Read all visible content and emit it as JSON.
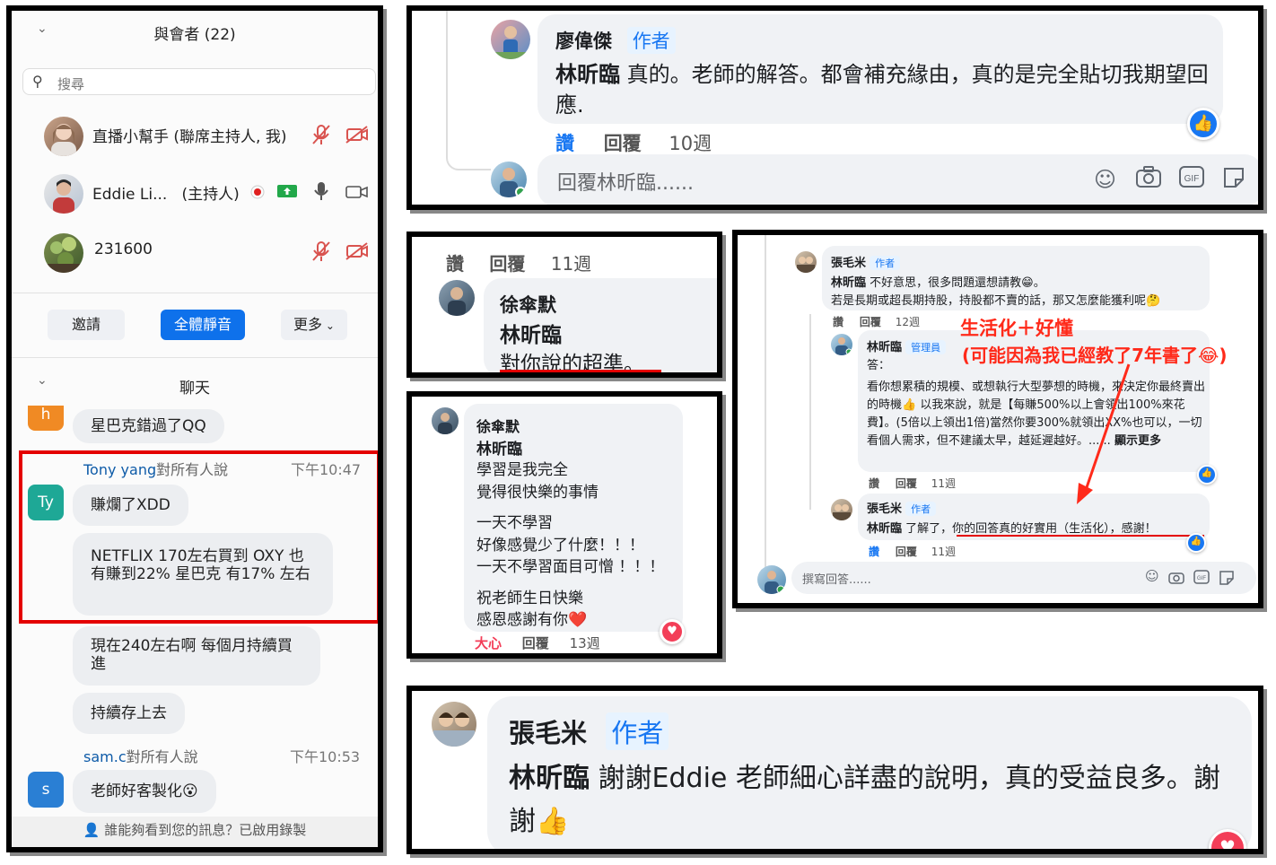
{
  "zoom": {
    "header": "與會者 (22)",
    "search_placeholder": "搜尋",
    "participants": [
      {
        "name": "直播小幫手 (聯席主持人, 我)"
      },
      {
        "name": "Eddie Li...",
        "role": "(主持人)"
      },
      {
        "name": "231600"
      }
    ],
    "buttons": {
      "invite": "邀請",
      "mute_all": "全體靜音",
      "more": "更多"
    },
    "chat_title": "聊天",
    "messages": {
      "h_avatar": "h",
      "m0": "星巴克錯過了QQ",
      "tony_sender": "Tony yang",
      "tony_to": "對所有人說",
      "tony_time": "下午10:47",
      "tony_avatar": "Ty",
      "m1": "賺爛了XDD",
      "m2": "NETFLIX 170左右買到 OXY 也有賺到22%  星巴克 有17% 左右",
      "m3": "現在240左右啊  每個月持續買進",
      "m4": "持續存上去",
      "sam_sender": "sam.c",
      "sam_to": "對所有人說",
      "sam_time": "下午10:53",
      "sam_avatar": "s",
      "m5": "老師好客製化😮"
    },
    "footer": "誰能夠看到您的訊息？已啟用錄製"
  },
  "panelA": {
    "name": "廖偉傑",
    "tag": "作者",
    "mention": "林昕臨",
    "text": "真的。老師的解答。都會補充緣由，真的是完全貼切我期望回應.",
    "like": "讚",
    "reply": "回覆",
    "time": "10週",
    "reply_placeholder": "回覆林昕臨......"
  },
  "panelB": {
    "like": "讚",
    "reply": "回覆",
    "time": "11週",
    "name": "徐傘默",
    "mention": "林昕臨",
    "text": "對你說的超準。"
  },
  "panelC": {
    "name": "徐傘默",
    "mention": "林昕臨",
    "lines": [
      "學習是我完全",
      "覺得很快樂的事情",
      "",
      "一天不學習",
      "好像感覺少了什麼！！！",
      "一天不學習面目可憎 ！！！",
      "",
      "祝老師生日快樂",
      "感恩感謝有你❤️"
    ],
    "reaction": "大心",
    "reply": "回覆",
    "time": "13週"
  },
  "panelD": {
    "c1_name": "張毛米",
    "c1_tag": "作者",
    "c1_mention": "林昕臨",
    "c1_line1": "不好意思，很多問題還想請教😁。",
    "c1_line2": "若是長期或超長期持股，持股都不賣的話，那又怎麼能獲利呢🤔",
    "c1_like": "讚",
    "c1_reply": "回覆",
    "c1_time": "12週",
    "c2_name": "林昕臨",
    "c2_tag": "管理員",
    "c2_intro": "答：",
    "c2_body": "看你想累積的規模、或想執行大型夢想的時機，來決定你最終賣出的時機👍 以我來說，就是【每賺500%以上會領出100%來花費】。(5倍以上領出1倍)當然你要300%就領出XX%也可以，一切看個人需求，但不建議太早，越延遲越好。......",
    "c2_more": "顯示更多",
    "c2_like": "讚",
    "c2_reply": "回覆",
    "c2_time": "11週",
    "c3_name": "張毛米",
    "c3_tag": "作者",
    "c3_mention": "林昕臨",
    "c3_text_a": "了解了，",
    "c3_text_b": "你的回答真的好實用（生活化），感謝！",
    "c3_like": "讚",
    "c3_reply": "回覆",
    "c3_time": "11週",
    "reply_placeholder": "撰寫回答......",
    "annotation_1": "生活化＋好懂",
    "annotation_2": "(可能因為我已經教了7年書了😂)"
  },
  "panelE": {
    "name": "張毛米",
    "tag": "作者",
    "mention": "林昕臨",
    "text_line1": "謝謝Eddie 老師細心詳盡的說明，真的受益良多。謝",
    "text_line2": "謝👍"
  },
  "colors": {
    "fb_blue": "#1877f2",
    "zoom_blue": "#0e71eb",
    "annotation_red": "#ff2a1a",
    "highlight_box": "#e40000",
    "heart": "#f33e58"
  }
}
